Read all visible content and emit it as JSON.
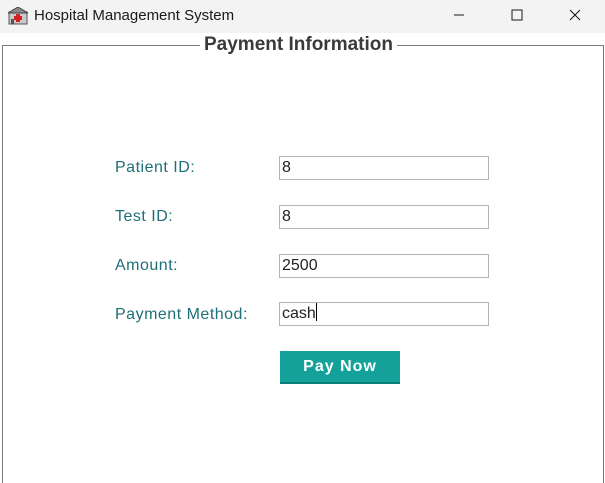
{
  "window": {
    "title": "Hospital Management System",
    "icon": "hospital-app-icon",
    "controls": [
      "minimize-icon",
      "maximize-icon",
      "close-icon"
    ]
  },
  "panel": {
    "legend": "Payment Information"
  },
  "form": {
    "patient_id": {
      "label": "Patient ID:",
      "value": "8"
    },
    "test_id": {
      "label": "Test ID:",
      "value": "8"
    },
    "amount": {
      "label": "Amount:",
      "value": "2500"
    },
    "payment_method": {
      "label": "Payment Method:",
      "value": "cash"
    }
  },
  "actions": {
    "pay_label": "Pay Now"
  },
  "colors": {
    "label": "#1f6f78",
    "button": "#14a19a",
    "titlebar": "#f3f3f3"
  }
}
